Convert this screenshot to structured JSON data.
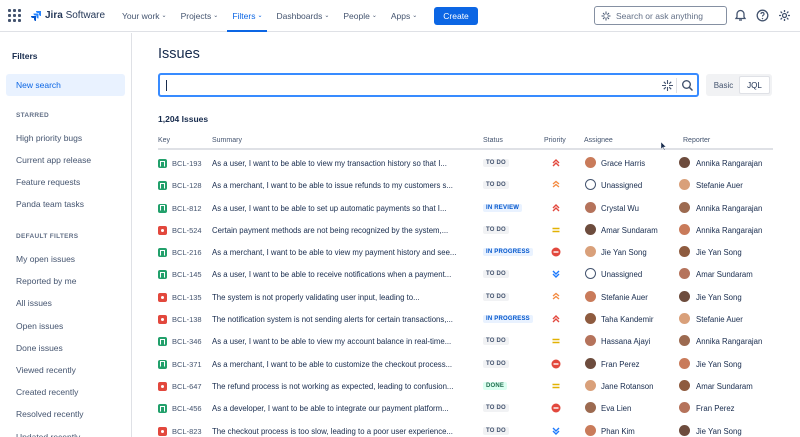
{
  "app": {
    "name_prefix": "Jira",
    "name_suffix": " Software"
  },
  "nav": {
    "items": [
      {
        "label": "Your work",
        "active": false
      },
      {
        "label": "Projects",
        "active": false
      },
      {
        "label": "Filters",
        "active": true
      },
      {
        "label": "Dashboards",
        "active": false
      },
      {
        "label": "People",
        "active": false
      },
      {
        "label": "Apps",
        "active": false
      }
    ],
    "create_label": "Create",
    "search_placeholder": "Search or ask anything"
  },
  "sidebar": {
    "title": "Filters",
    "new_search": "New search",
    "starred_heading": "STARRED",
    "starred": [
      "High priority bugs",
      "Current app release",
      "Feature requests",
      "Panda team tasks"
    ],
    "default_heading": "DEFAULT FILTERS",
    "defaults": [
      "My open issues",
      "Reported by me",
      "All issues",
      "Open issues",
      "Done issues",
      "Viewed recently",
      "Created recently",
      "Resolved recently",
      "Updated recently"
    ]
  },
  "main": {
    "title": "Issues",
    "toggle": {
      "basic": "Basic",
      "jql": "JQL"
    },
    "issue_count": "1,204 Issues",
    "columns": {
      "key": "Key",
      "summary": "Summary",
      "status": "Status",
      "priority": "Priority",
      "assignee": "Assignee",
      "reporter": "Reporter"
    }
  },
  "colors": {
    "accent": "#0c66e4",
    "story": "#22a06b",
    "bug": "#e2483d"
  },
  "issues": [
    {
      "type": "story",
      "key": "BCL-193",
      "summary": "As a user, I want to be able to view my transaction history so that I...",
      "status": "TO DO",
      "priority": "highest",
      "assignee": "Grace Harris",
      "reporter": "Annika Rangarajan"
    },
    {
      "type": "story",
      "key": "BCL-128",
      "summary": "As a merchant, I want to be able to issue refunds to my customers s...",
      "status": "TO DO",
      "priority": "high",
      "assignee": "Unassigned",
      "reporter": "Stefanie Auer"
    },
    {
      "type": "story",
      "key": "BCL-812",
      "summary": "As a user, I want to be able to set up automatic payments so that I...",
      "status": "IN REVIEW",
      "priority": "highest",
      "assignee": "Crystal Wu",
      "reporter": "Annika Rangarajan"
    },
    {
      "type": "bug",
      "key": "BCL-524",
      "summary": "Certain payment methods are not being recognized by the system,...",
      "status": "TO DO",
      "priority": "medium",
      "assignee": "Amar Sundaram",
      "reporter": "Annika Rangarajan"
    },
    {
      "type": "story",
      "key": "BCL-216",
      "summary": "As a merchant, I want to be able to view my payment history and see...",
      "status": "IN PROGRESS",
      "priority": "blocker",
      "assignee": "Jie Yan Song",
      "reporter": "Jie Yan Song"
    },
    {
      "type": "story",
      "key": "BCL-145",
      "summary": "As a user, I want to be able to receive notifications when a payment...",
      "status": "TO DO",
      "priority": "lowest",
      "assignee": "Unassigned",
      "reporter": "Amar Sundaram"
    },
    {
      "type": "bug",
      "key": "BCL-135",
      "summary": "The system is not properly validating user input, leading to...",
      "status": "TO DO",
      "priority": "high",
      "assignee": "Stefanie Auer",
      "reporter": "Jie Yan Song"
    },
    {
      "type": "bug",
      "key": "BCL-138",
      "summary": "The notification system is not sending alerts for certain transactions,...",
      "status": "IN PROGRESS",
      "priority": "highest",
      "assignee": "Taha Kandemir",
      "reporter": "Stefanie Auer"
    },
    {
      "type": "story",
      "key": "BCL-346",
      "summary": "As a user, I want to be able to view my account balance in real-time...",
      "status": "TO DO",
      "priority": "medium",
      "assignee": "Hassana Ajayi",
      "reporter": "Annika Rangarajan"
    },
    {
      "type": "story",
      "key": "BCL-371",
      "summary": "As a merchant, I want to be able to customize the checkout process...",
      "status": "TO DO",
      "priority": "blocker",
      "assignee": "Fran Perez",
      "reporter": "Jie Yan Song"
    },
    {
      "type": "bug",
      "key": "BCL-647",
      "summary": "The refund process is not working as expected, leading to confusion...",
      "status": "DONE",
      "priority": "medium",
      "assignee": "Jane Rotanson",
      "reporter": "Amar Sundaram"
    },
    {
      "type": "story",
      "key": "BCL-456",
      "summary": "As a developer, I want to be able to integrate our payment platform...",
      "status": "TO DO",
      "priority": "blocker",
      "assignee": "Eva Lien",
      "reporter": "Fran Perez"
    },
    {
      "type": "bug",
      "key": "BCL-823",
      "summary": "The checkout process is too slow, leading to a poor user experience...",
      "status": "TO DO",
      "priority": "lowest",
      "assignee": "Phan Kim",
      "reporter": "Jie Yan Song"
    }
  ]
}
